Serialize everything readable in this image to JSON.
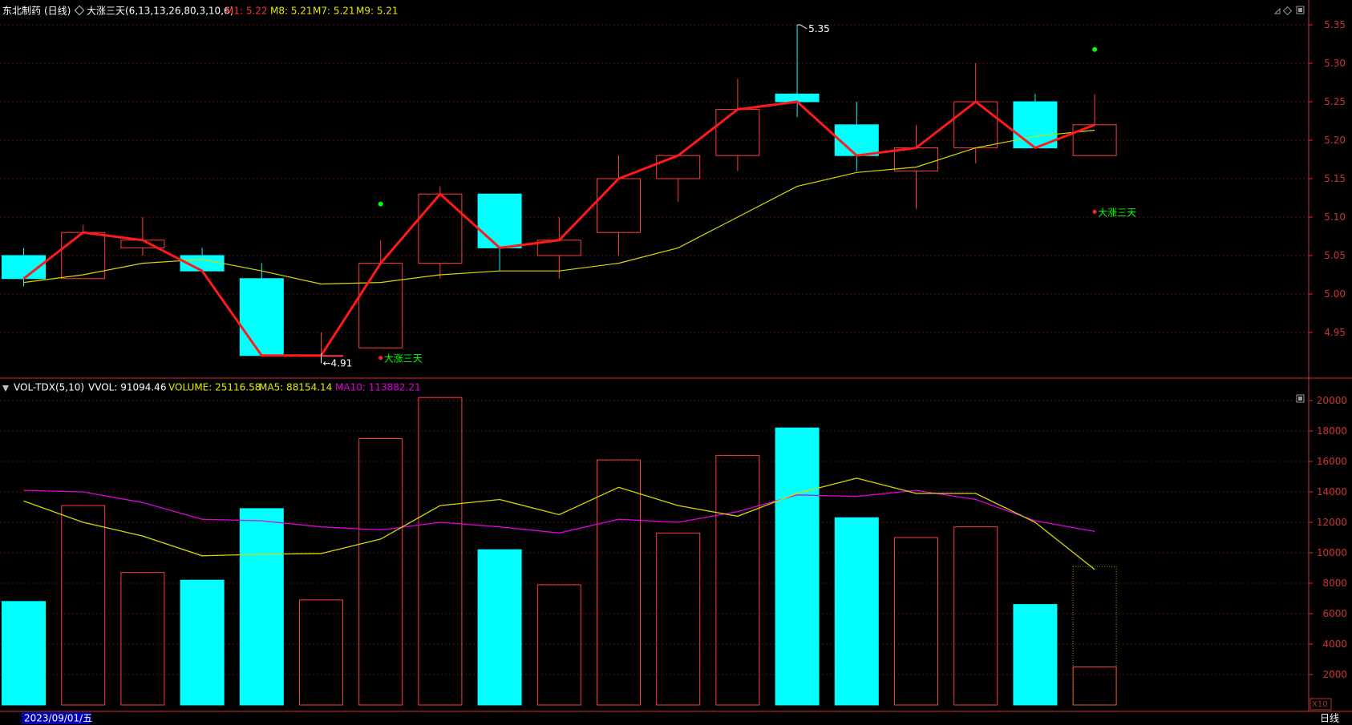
{
  "price_header": {
    "stock_name": "东北制药",
    "period": "(日线)",
    "indicator": "大涨三天(6,13,13,26,80,3,10,6)",
    "m1": "M1: 5.22",
    "m8": "M8: 5.21",
    "m7": "M7: 5.21",
    "m9": "M9: 5.21"
  },
  "vol_header": {
    "name": "VOL-TDX(5,10)",
    "vvol": "VVOL: 91094.46",
    "volume": "VOLUME: 25116.58",
    "ma5": "MA5: 88154.14",
    "ma10": "MA10: 113882.21"
  },
  "bottom_bar": {
    "date": "2023/09/01/五",
    "period_button": "日线",
    "scale": "X10"
  },
  "colors": {
    "up": "#ff3c3c",
    "down": "#00ffff",
    "red_line": "#ff1a1a",
    "yellow_line": "#d8d800",
    "magenta_line": "#e000e0",
    "axis": "#cc3333",
    "grid": "#5a0f0f",
    "green": "#00ff00"
  },
  "chart_data": [
    {
      "type": "candlestick",
      "ylim": [
        4.88,
        5.37
      ],
      "yticks": [
        "5.35",
        "5.30",
        "5.25",
        "5.20",
        "5.15",
        "5.10",
        "5.05",
        "5.00",
        "4.95"
      ],
      "candles": [
        {
          "o": 5.05,
          "h": 5.06,
          "l": 5.01,
          "c": 5.02
        },
        {
          "o": 5.02,
          "h": 5.09,
          "l": 5.02,
          "c": 5.08
        },
        {
          "o": 5.06,
          "h": 5.1,
          "l": 5.05,
          "c": 5.07
        },
        {
          "o": 5.05,
          "h": 5.06,
          "l": 5.03,
          "c": 5.03
        },
        {
          "o": 5.02,
          "h": 5.04,
          "l": 4.92,
          "c": 4.92
        },
        {
          "o": 4.92,
          "h": 4.95,
          "l": 4.91,
          "c": 4.92
        },
        {
          "o": 4.93,
          "h": 5.07,
          "l": 4.93,
          "c": 5.04
        },
        {
          "o": 5.04,
          "h": 5.14,
          "l": 5.02,
          "c": 5.13
        },
        {
          "o": 5.13,
          "h": 5.13,
          "l": 5.03,
          "c": 5.06
        },
        {
          "o": 5.05,
          "h": 5.1,
          "l": 5.02,
          "c": 5.07
        },
        {
          "o": 5.08,
          "h": 5.18,
          "l": 5.05,
          "c": 5.15
        },
        {
          "o": 5.15,
          "h": 5.18,
          "l": 5.12,
          "c": 5.18
        },
        {
          "o": 5.18,
          "h": 5.28,
          "l": 5.16,
          "c": 5.24
        },
        {
          "o": 5.26,
          "h": 5.35,
          "l": 5.23,
          "c": 5.25
        },
        {
          "o": 5.22,
          "h": 5.25,
          "l": 5.16,
          "c": 5.18
        },
        {
          "o": 5.16,
          "h": 5.22,
          "l": 5.11,
          "c": 5.19
        },
        {
          "o": 5.19,
          "h": 5.3,
          "l": 5.17,
          "c": 5.25
        },
        {
          "o": 5.25,
          "h": 5.26,
          "l": 5.19,
          "c": 5.19
        },
        {
          "o": 5.18,
          "h": 5.26,
          "l": 5.18,
          "c": 5.22
        }
      ],
      "red_line": [
        5.02,
        5.08,
        5.07,
        5.03,
        4.92,
        4.92,
        5.04,
        5.13,
        5.06,
        5.07,
        5.15,
        5.18,
        5.24,
        5.25,
        5.18,
        5.19,
        5.25,
        5.19,
        5.22
      ],
      "yellow_line": [
        5.015,
        5.025,
        5.04,
        5.045,
        5.03,
        5.013,
        5.015,
        5.025,
        5.03,
        5.03,
        5.04,
        5.06,
        5.1,
        5.14,
        5.158,
        5.165,
        5.19,
        5.205,
        5.213
      ],
      "annotations": {
        "high_label": "5.35",
        "high_index": 13,
        "high_value": 5.35,
        "low_label": "4.91",
        "low_index": 5,
        "low_value": 4.91,
        "signal_text": "大涨三天",
        "signals": [
          {
            "index": 6,
            "value": 4.917
          },
          {
            "index": 18,
            "value": 5.107
          }
        ],
        "green_dots": [
          {
            "index": 6,
            "value": 5.117
          },
          {
            "index": 18,
            "value": 5.318
          }
        ]
      }
    },
    {
      "type": "bar",
      "ylim": [
        0,
        20400
      ],
      "yticks": [
        "20000",
        "18000",
        "16000",
        "14000",
        "12000",
        "10000",
        "8000",
        "6000",
        "4000",
        "2000"
      ],
      "volumes": [
        6800,
        13100,
        8700,
        8200,
        12900,
        6900,
        17500,
        20200,
        10200,
        7900,
        16100,
        11300,
        16400,
        18200,
        12300,
        11000,
        11700,
        6600,
        2500
      ],
      "up": [
        false,
        true,
        true,
        false,
        false,
        true,
        true,
        true,
        false,
        true,
        true,
        true,
        true,
        false,
        false,
        true,
        true,
        false,
        true
      ],
      "ma5": [
        13400,
        12000,
        11100,
        9800,
        9900,
        9950,
        10900,
        13100,
        13500,
        12500,
        14300,
        13100,
        12400,
        13900,
        14900,
        13900,
        13900,
        12000,
        8900
      ],
      "ma10": [
        14100,
        14000,
        13300,
        12200,
        12100,
        11700,
        11500,
        12000,
        11700,
        11300,
        12200,
        12000,
        12700,
        13800,
        13700,
        14100,
        13500,
        12100,
        11400
      ],
      "estimated_volume": 9100
    }
  ]
}
